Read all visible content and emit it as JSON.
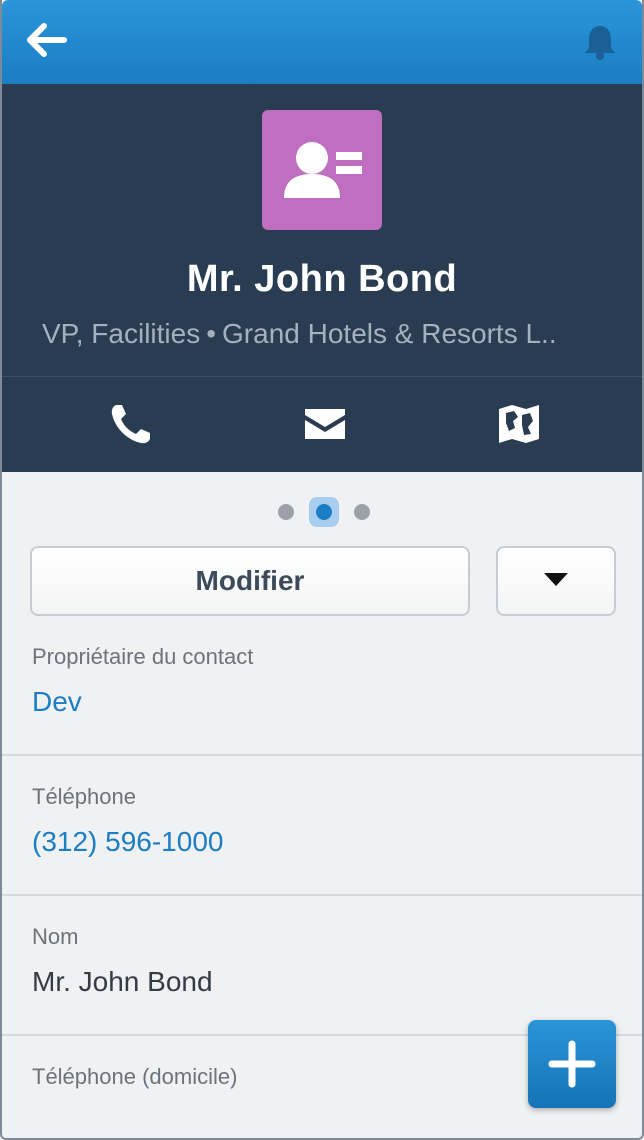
{
  "topbar": {
    "back_icon": "arrow-left-icon",
    "notification_icon": "bell-icon",
    "color": "#1b7dc3"
  },
  "record": {
    "avatar_icon": "contact-card-icon",
    "avatar_color": "#bf6ec0",
    "name": "Mr. John Bond",
    "role": "VP, Facilities",
    "separator": "•",
    "company": "Grand Hotels & Resorts L.."
  },
  "actions": [
    {
      "icon": "phone-icon"
    },
    {
      "icon": "envelope-icon"
    },
    {
      "icon": "map-icon"
    }
  ],
  "pager": {
    "count": 3,
    "active": 2
  },
  "buttons": {
    "edit_label": "Modifier",
    "more_icon": "caret-down-icon"
  },
  "fields": [
    {
      "label": "Propriétaire du contact",
      "value": "Dev",
      "link": true
    },
    {
      "label": "Téléphone",
      "value": "(312) 596-1000",
      "link": true
    },
    {
      "label": "Nom",
      "value": "Mr. John Bond",
      "link": false
    },
    {
      "label": "Téléphone (domicile)",
      "value": "",
      "link": false
    }
  ],
  "fab": {
    "icon": "plus-icon"
  }
}
